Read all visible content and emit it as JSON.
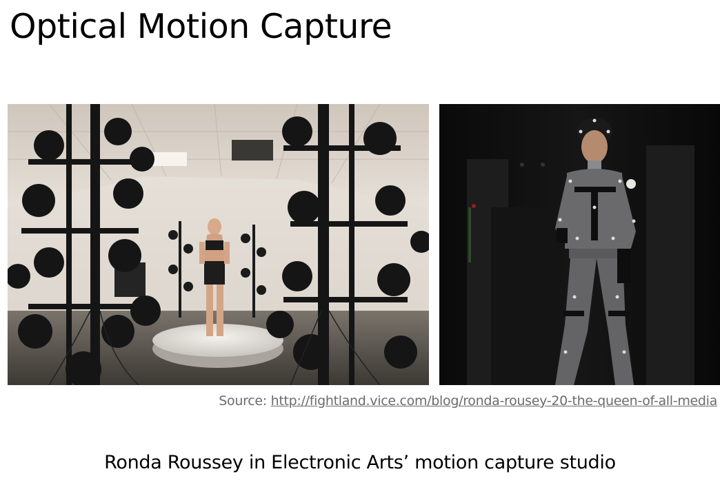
{
  "slide": {
    "title": "Optical Motion Capture",
    "source_label": "Source:",
    "source_url": "http://fightland.vice.com/blog/ronda-rousey-20-the-queen-of-all-media",
    "caption": "Ronda Roussey in Electronic Arts’ motion capture studio"
  },
  "images": {
    "left": "motion-capture-studio-camera-rig-photo",
    "right": "performer-in-mocap-suit-photo"
  },
  "colors": {
    "background": "#ffffff",
    "title_text": "#000000",
    "source_text": "#6b6b6b",
    "mocap_suit": "#6a6a6c",
    "studio_dark": "#0d0d0d"
  }
}
